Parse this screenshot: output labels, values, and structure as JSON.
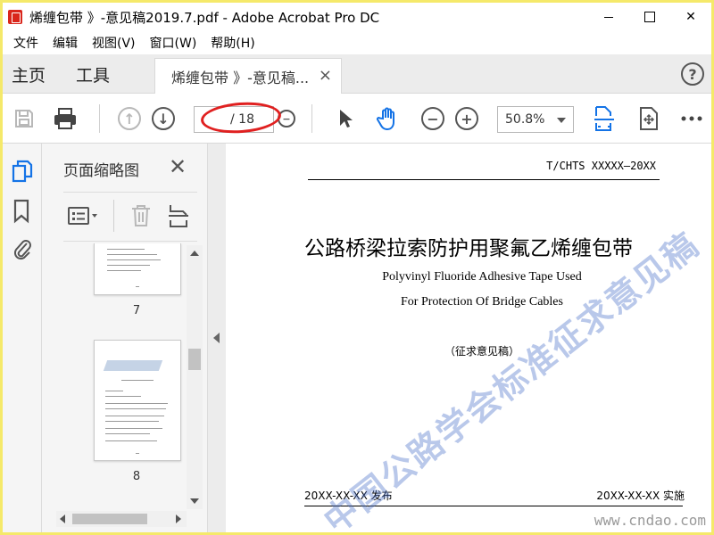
{
  "window": {
    "title": "烯缠包带 》-意见稿2019.7.pdf - Adobe Acrobat Pro DC",
    "minimize_label": "",
    "close_label": "✕"
  },
  "menu": {
    "items": [
      "文件",
      "编辑",
      "视图(V)",
      "窗口(W)",
      "帮助(H)"
    ]
  },
  "tabs": {
    "home": "主页",
    "tools": "工具",
    "document": "烯缠包带 》-意见稿...",
    "close": "×",
    "help": "?"
  },
  "toolbar": {
    "page_current": "",
    "page_total": "/ 18",
    "zoom": "50.8%"
  },
  "thumbnails": {
    "title": "页面缩略图",
    "close": "✕",
    "pages": [
      {
        "label": "7"
      },
      {
        "label": "8"
      }
    ]
  },
  "document": {
    "standard_code": "T/CHTS XXXXX—20XX",
    "title_cn": "公路桥梁拉索防护用聚氟乙烯缠包带",
    "title_en_line1": "Polyvinyl Fluoride Adhesive Tape Used",
    "title_en_line2": "For Protection Of Bridge Cables",
    "draft_note": "（征求意见稿）",
    "publish_date": "20XX-XX-XX 发布",
    "implement_date": "20XX-XX-XX 实施",
    "watermark": "中国公路学会标准征求意见稿"
  },
  "site": "www.cndao.com",
  "colors": {
    "accent_blue": "#1473e6",
    "annotation_red": "#e02020",
    "frame_yellow": "#f5e96a"
  }
}
